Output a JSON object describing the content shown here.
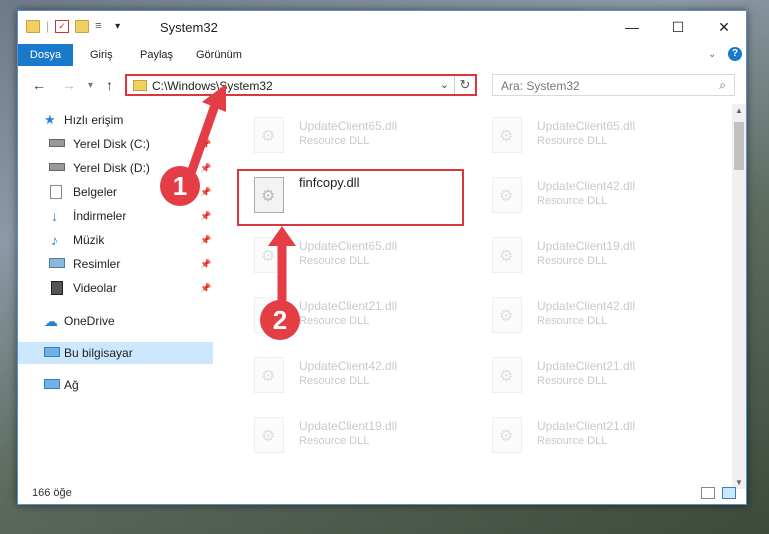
{
  "window": {
    "title": "System32"
  },
  "ribbon": {
    "tabs": [
      "Dosya",
      "Giriş",
      "Paylaş",
      "Görünüm"
    ]
  },
  "address": {
    "path": "C:\\Windows\\System32"
  },
  "search": {
    "placeholder": "Ara: System32"
  },
  "sidebar": {
    "items": [
      {
        "label": "Hızlı erişim",
        "icon": "star-icon"
      },
      {
        "label": "Yerel Disk (C:)",
        "icon": "drive-icon"
      },
      {
        "label": "Yerel Disk (D:)",
        "icon": "drive-icon"
      },
      {
        "label": "Belgeler",
        "icon": "documents-icon"
      },
      {
        "label": "İndirmeler",
        "icon": "download-icon"
      },
      {
        "label": "Müzik",
        "icon": "music-icon"
      },
      {
        "label": "Resimler",
        "icon": "pictures-icon"
      },
      {
        "label": "Videolar",
        "icon": "videos-icon"
      },
      {
        "label": "OneDrive",
        "icon": "cloud-icon"
      },
      {
        "label": "Bu bilgisayar",
        "icon": "computer-icon"
      },
      {
        "label": "Ağ",
        "icon": "network-icon"
      }
    ]
  },
  "files": {
    "highlighted": {
      "name": "finfcopy.dll",
      "type": ""
    },
    "faded": [
      {
        "name": "UpdateClient65.dll",
        "type": "Resource DLL"
      },
      {
        "name": "UpdateClient65.dll",
        "type": "Resource DLL"
      },
      {
        "name": "UpdateClient42.dll",
        "type": "Resource DLL"
      },
      {
        "name": "UpdateClient65.dll",
        "type": "Resource DLL"
      },
      {
        "name": "UpdateClient19.dll",
        "type": "Resource DLL"
      },
      {
        "name": "UpdateClient21.dll",
        "type": "Resource DLL"
      },
      {
        "name": "UpdateClient42.dll",
        "type": "Resource DLL"
      },
      {
        "name": "UpdateClient42.dll",
        "type": "Resource DLL"
      },
      {
        "name": "UpdateClient21.dll",
        "type": "Resource DLL"
      },
      {
        "name": "UpdateClient19.dll",
        "type": "Resource DLL"
      },
      {
        "name": "UpdateClient21.dll",
        "type": "Resource DLL"
      }
    ]
  },
  "status": {
    "count": "166 öğe"
  },
  "annotations": {
    "step1": "1",
    "step2": "2"
  },
  "colors": {
    "accent": "#1979ca",
    "annotation": "#e43d46"
  }
}
